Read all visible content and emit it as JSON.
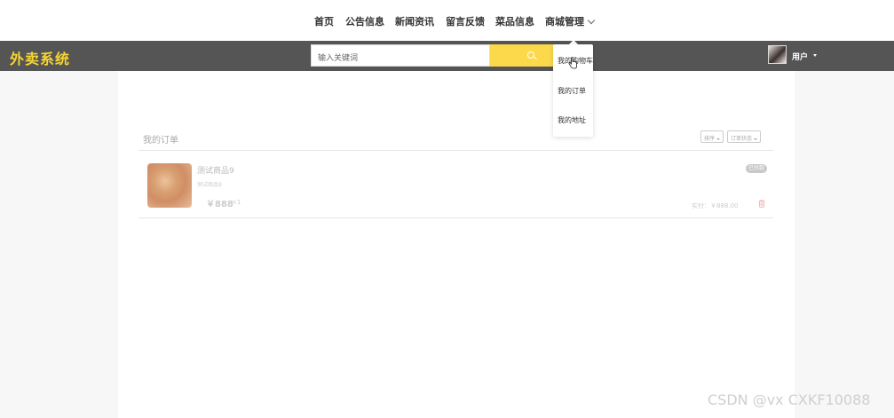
{
  "nav": {
    "items": [
      "首页",
      "公告信息",
      "新闻资讯",
      "留言反馈",
      "菜品信息",
      "商城管理"
    ]
  },
  "header": {
    "logo": "外卖系统",
    "search_placeholder": "输入关键词",
    "user_label": "用户"
  },
  "dropdown": {
    "items": [
      "我的购物车",
      "我的订单",
      "我的地址"
    ]
  },
  "orders": {
    "title": "我的订单",
    "filters": [
      "排序",
      "订单状态"
    ],
    "items": [
      {
        "name": "测试商品9",
        "subtitle": "测试商品9",
        "price": "￥888",
        "qty": "×1",
        "status": "已付款",
        "paid": "实付：￥888.00"
      }
    ]
  },
  "watermark": "CSDN @vx  CXKF10088",
  "colors": {
    "accent": "#fcd94a",
    "logo": "#f5d633",
    "topbar": "#555555"
  }
}
